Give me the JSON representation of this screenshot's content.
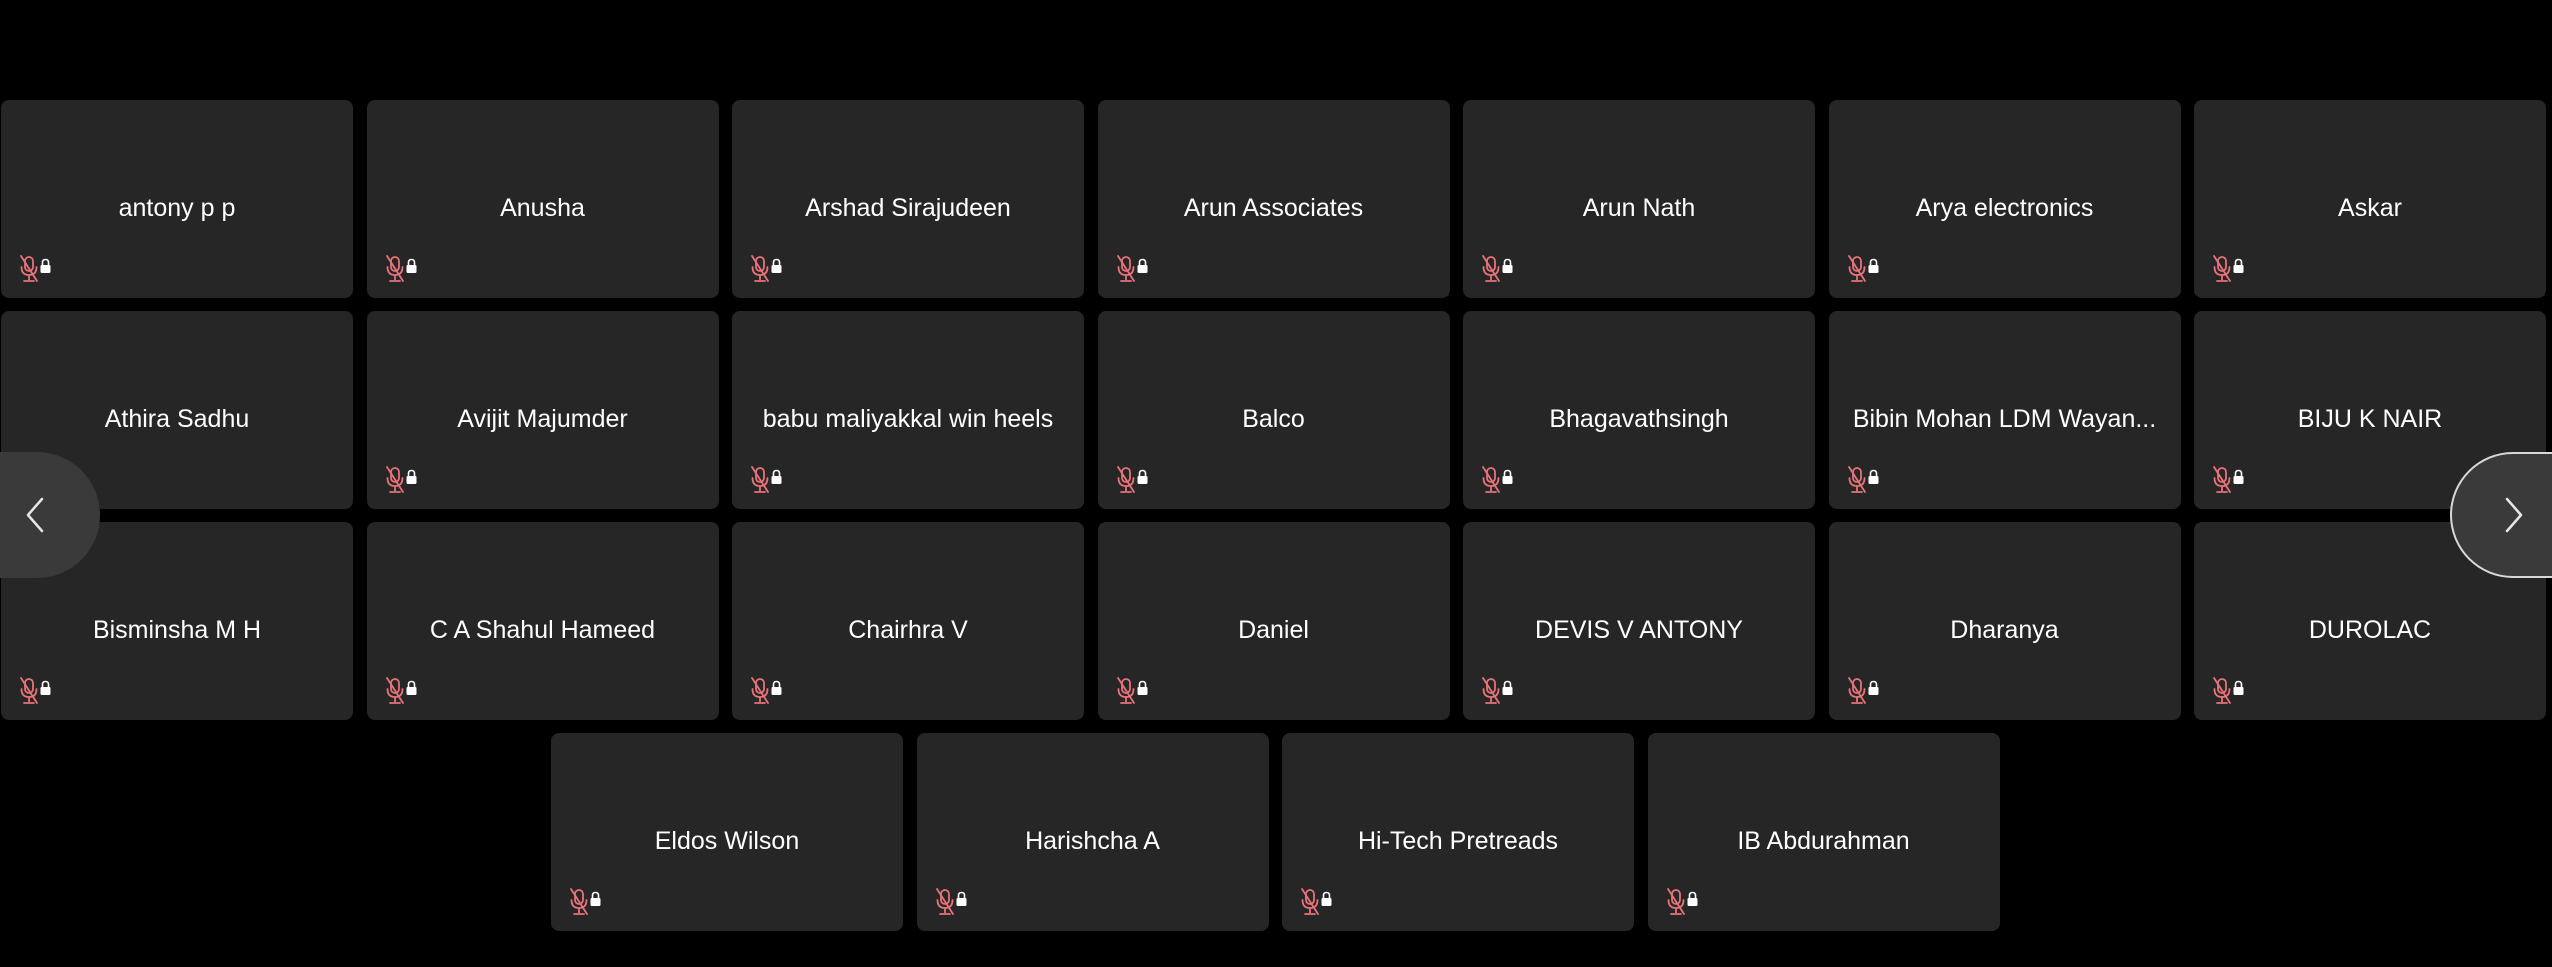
{
  "colors": {
    "background": "#000000",
    "tile": "#262626",
    "tile_text": "#ffffff",
    "muted_mic": "#e8737a",
    "nav_button": "#3a3a3a"
  },
  "icons": {
    "mic": "mic-off-icon",
    "lock": "lock-icon",
    "prev": "chevron-left-icon",
    "next": "chevron-right-icon"
  },
  "participants": [
    {
      "name": "antony p p"
    },
    {
      "name": "Anusha"
    },
    {
      "name": "Arshad Sirajudeen"
    },
    {
      "name": "Arun Associates"
    },
    {
      "name": "Arun Nath"
    },
    {
      "name": "Arya electronics"
    },
    {
      "name": "Askar"
    },
    {
      "name": "Athira Sadhu"
    },
    {
      "name": "Avijit Majumder"
    },
    {
      "name": "babu maliyakkal win heels"
    },
    {
      "name": "Balco"
    },
    {
      "name": "Bhagavathsingh"
    },
    {
      "name": "Bibin Mohan LDM Wayan..."
    },
    {
      "name": "BIJU K NAIR"
    },
    {
      "name": "Bisminsha M H"
    },
    {
      "name": "C A Shahul Hameed"
    },
    {
      "name": "Chairhra V"
    },
    {
      "name": "Daniel"
    },
    {
      "name": "DEVIS V ANTONY"
    },
    {
      "name": "Dharanya"
    },
    {
      "name": "DUROLAC"
    },
    {
      "name": "Eldos Wilson"
    },
    {
      "name": "Harishcha A"
    },
    {
      "name": "Hi-Tech Pretreads"
    },
    {
      "name": "IB Abdurahman"
    }
  ]
}
